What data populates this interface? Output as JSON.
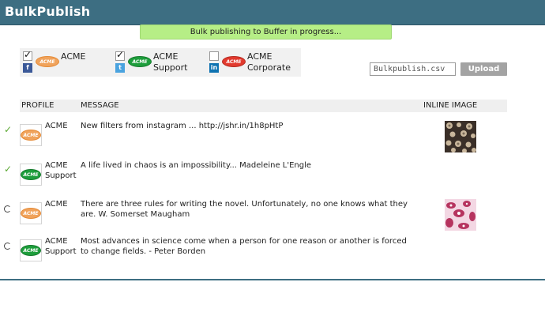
{
  "app": {
    "title": "BulkPublish"
  },
  "progress": {
    "text": "Bulk publishing to Buffer in progress..."
  },
  "profiles": [
    {
      "name_line1": "ACME",
      "name_line2": "",
      "network": "f",
      "network_icon": "facebook-icon",
      "logo_color": "#f0a35c",
      "checked": true,
      "check_glyph": "✓"
    },
    {
      "name_line1": "ACME",
      "name_line2": "Support",
      "network": "t",
      "network_icon": "twitter-icon",
      "logo_color": "#1e9e3c",
      "checked": true,
      "check_glyph": "✓"
    },
    {
      "name_line1": "ACME",
      "name_line2": "Corporate",
      "network": "in",
      "network_icon": "linkedin-icon",
      "logo_color": "#e23a2e",
      "checked": false,
      "check_glyph": ""
    }
  ],
  "logo_text": "ACME",
  "upload": {
    "file_name": "Bulkpublish.csv",
    "button_label": "Upload"
  },
  "table": {
    "headers": {
      "profile": "PROFILE",
      "message": "MESSAGE",
      "image": "INLINE IMAGE"
    },
    "rows": [
      {
        "status": "done",
        "status_glyph": "✓",
        "profile_line1": "ACME",
        "profile_line2": "",
        "logo": "orange",
        "message": "New filters from instagram ... http://jshr.in/1h8pHtP",
        "has_image": true
      },
      {
        "status": "done",
        "status_glyph": "✓",
        "profile_line1": "ACME",
        "profile_line2": "Support",
        "logo": "green",
        "message": "A life lived in chaos is an impossibility... Madeleine L'Engle",
        "has_image": false
      },
      {
        "status": "pending",
        "status_glyph": "",
        "profile_line1": "ACME",
        "profile_line2": "",
        "logo": "orange",
        "message": "There are three rules for writing the novel. Unfortunately, no one knows what they are. W. Somerset Maugham",
        "has_image": true
      },
      {
        "status": "pending",
        "status_glyph": "",
        "profile_line1": "ACME",
        "profile_line2": "Support",
        "logo": "green",
        "message": "Most advances in science come when a person for one reason or another is forced to change fields. - Peter Borden",
        "has_image": false
      }
    ]
  },
  "colors": {
    "header": "#3d6e82",
    "progress": "#b6ee86",
    "check": "#5aa832"
  }
}
